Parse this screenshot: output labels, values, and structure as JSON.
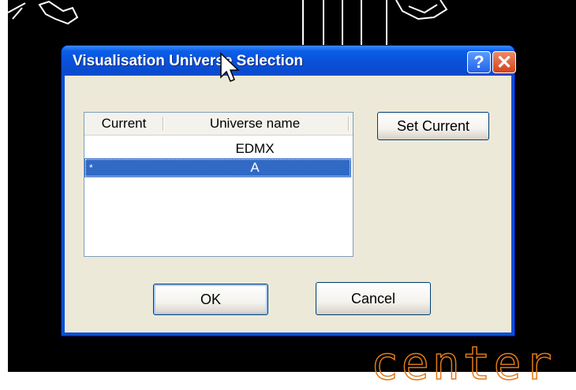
{
  "background": {
    "viewport_text": "center",
    "viewport_text_color": "#e07a1a"
  },
  "dialog": {
    "title": "Visualisation Universe Selection",
    "help_label": "?",
    "close_label": "✕",
    "list": {
      "columns": [
        "Current",
        "Universe name"
      ],
      "rows": [
        {
          "current": "",
          "name": "EDMX",
          "selected": false
        },
        {
          "current": "*",
          "name": "A",
          "selected": true
        }
      ]
    },
    "set_current_label": "Set Current",
    "ok_label": "OK",
    "cancel_label": "Cancel"
  },
  "colors": {
    "titlebar": "#0a50d8",
    "selection": "#316ac5",
    "dialog_face": "#ece9d8"
  }
}
